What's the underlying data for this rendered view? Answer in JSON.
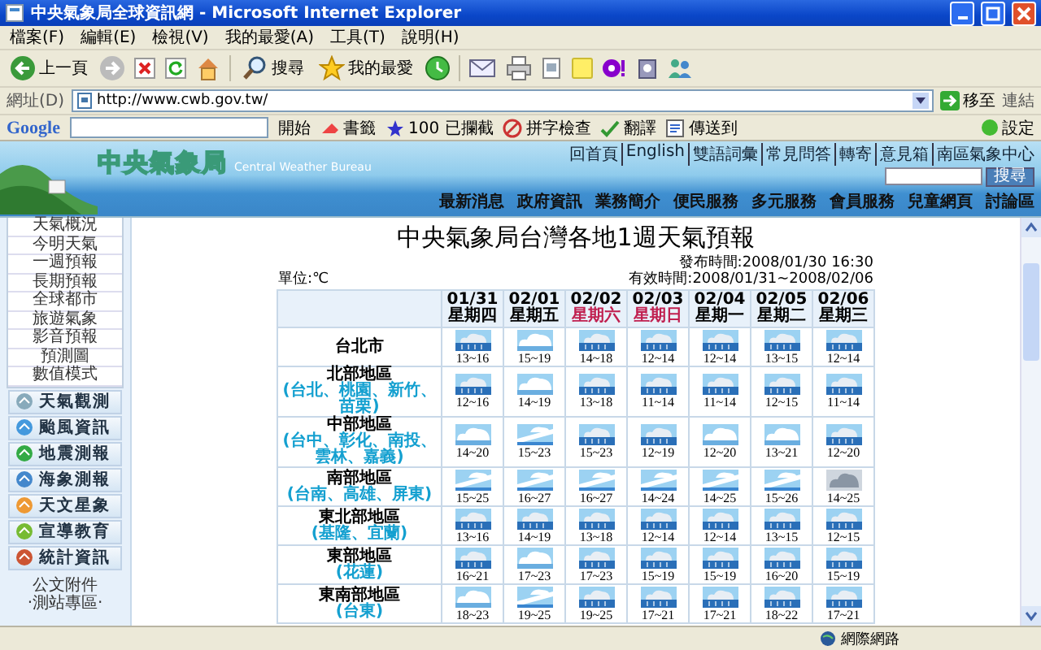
{
  "window": {
    "title": "中央氣象局全球資訊網 - Microsoft Internet Explorer"
  },
  "menu_bar": [
    "檔案(F)",
    "編輯(E)",
    "檢視(V)",
    "我的最愛(A)",
    "工具(T)",
    "說明(H)"
  ],
  "toolbar": {
    "back": "上一頁",
    "search": "搜尋",
    "favorites": "我的最愛"
  },
  "address_bar": {
    "label": "網址(D)",
    "value": "http://www.cwb.gov.tw/",
    "go": "移至",
    "links": "連結"
  },
  "google_toolbar": {
    "logo": "Google",
    "search": "開始",
    "items": [
      "書籤",
      "100 已攔截",
      "拼字檢查",
      "翻譯",
      "傳送到"
    ],
    "settings": "設定"
  },
  "site_header": {
    "logo": "中央氣象局",
    "logo_subtitle": "Central Weather Bureau",
    "top_links": [
      "回首頁",
      "English",
      "雙語詞彙",
      "常見問答",
      "轉寄",
      "意見箱",
      "南區氣象中心"
    ],
    "search_button": "搜尋",
    "nav": [
      "最新消息",
      "政府資訊",
      "業務簡介",
      "便民服務",
      "多元服務",
      "會員服務",
      "兒童網頁",
      "討論區"
    ]
  },
  "sidebar": {
    "links": [
      "天氣概況",
      "今明天氣",
      "一週預報",
      "長期預報",
      "全球都市",
      "旅遊氣象",
      "影音預報",
      "預測圖",
      "數值模式"
    ],
    "sections": [
      "天氣觀測",
      "颱風資訊",
      "地震測報",
      "海象測報",
      "天文星象",
      "宣導教育",
      "統計資訊"
    ],
    "footer_links": [
      "公文附件",
      "‧測站專區‧"
    ]
  },
  "forecast": {
    "title": "中央氣象局台灣各地1週天氣預報",
    "unit": "單位:℃",
    "published": "發布時間:2008/01/30 16:30",
    "valid": "有效時間:2008/01/31~2008/02/06",
    "days": [
      {
        "date": "01/31",
        "weekday": "星期四",
        "weekend": false
      },
      {
        "date": "02/01",
        "weekday": "星期五",
        "weekend": false
      },
      {
        "date": "02/02",
        "weekday": "星期六",
        "weekend": true
      },
      {
        "date": "02/03",
        "weekday": "星期日",
        "weekend": true
      },
      {
        "date": "02/04",
        "weekday": "星期一",
        "weekend": false
      },
      {
        "date": "02/05",
        "weekday": "星期二",
        "weekend": false
      },
      {
        "date": "02/06",
        "weekday": "星期三",
        "weekend": false
      }
    ],
    "regions": [
      {
        "name": "台北市",
        "cells": [
          {
            "kind": "rain",
            "temp": "13~16"
          },
          {
            "kind": "cloudy",
            "temp": "15~19"
          },
          {
            "kind": "rain",
            "temp": "14~18"
          },
          {
            "kind": "rain",
            "temp": "12~14"
          },
          {
            "kind": "rain",
            "temp": "12~14"
          },
          {
            "kind": "rain",
            "temp": "13~15"
          },
          {
            "kind": "rain",
            "temp": "12~14"
          }
        ]
      },
      {
        "name": "北部地區",
        "areas": "(台北、桃園、新竹、苗栗)",
        "cells": [
          {
            "kind": "rain",
            "temp": "12~16"
          },
          {
            "kind": "cloudy",
            "temp": "14~19"
          },
          {
            "kind": "rain",
            "temp": "13~18"
          },
          {
            "kind": "rain",
            "temp": "11~14"
          },
          {
            "kind": "rain",
            "temp": "11~14"
          },
          {
            "kind": "rain",
            "temp": "12~15"
          },
          {
            "kind": "rain",
            "temp": "11~14"
          }
        ]
      },
      {
        "name": "中部地區",
        "areas": "(台中、彰化、南投、雲林、嘉義)",
        "cells": [
          {
            "kind": "cloudy",
            "temp": "14~20"
          },
          {
            "kind": "partly",
            "temp": "15~23"
          },
          {
            "kind": "rain",
            "temp": "15~23"
          },
          {
            "kind": "rain",
            "temp": "12~19"
          },
          {
            "kind": "cloudy",
            "temp": "12~20"
          },
          {
            "kind": "cloudy",
            "temp": "13~21"
          },
          {
            "kind": "rain",
            "temp": "12~20"
          }
        ]
      },
      {
        "name": "南部地區",
        "areas": "(台南、高雄、屏東)",
        "cells": [
          {
            "kind": "partly",
            "temp": "15~25"
          },
          {
            "kind": "partly",
            "temp": "16~27"
          },
          {
            "kind": "partly",
            "temp": "16~27"
          },
          {
            "kind": "partly",
            "temp": "14~24"
          },
          {
            "kind": "partly",
            "temp": "14~25"
          },
          {
            "kind": "partly",
            "temp": "15~26"
          },
          {
            "kind": "overcast",
            "temp": "14~25"
          }
        ]
      },
      {
        "name": "東北部地區",
        "areas": "(基隆、宜蘭)",
        "cells": [
          {
            "kind": "rain",
            "temp": "13~16"
          },
          {
            "kind": "rain",
            "temp": "14~19"
          },
          {
            "kind": "rain",
            "temp": "13~18"
          },
          {
            "kind": "rain",
            "temp": "12~14"
          },
          {
            "kind": "rain",
            "temp": "12~14"
          },
          {
            "kind": "rain",
            "temp": "13~15"
          },
          {
            "kind": "rain",
            "temp": "12~15"
          }
        ]
      },
      {
        "name": "東部地區",
        "areas": "(花蓮)",
        "cells": [
          {
            "kind": "rain",
            "temp": "16~21"
          },
          {
            "kind": "cloudy",
            "temp": "17~23"
          },
          {
            "kind": "rain",
            "temp": "17~23"
          },
          {
            "kind": "rain",
            "temp": "15~19"
          },
          {
            "kind": "rain",
            "temp": "15~19"
          },
          {
            "kind": "rain",
            "temp": "16~20"
          },
          {
            "kind": "rain",
            "temp": "15~19"
          }
        ]
      },
      {
        "name": "東南部地區",
        "areas": "(台東)",
        "cells": [
          {
            "kind": "cloudy",
            "temp": "18~23"
          },
          {
            "kind": "partly",
            "temp": "19~25"
          },
          {
            "kind": "rain",
            "temp": "19~25"
          },
          {
            "kind": "rain",
            "temp": "17~21"
          },
          {
            "kind": "rain",
            "temp": "17~21"
          },
          {
            "kind": "rain",
            "temp": "18~22"
          },
          {
            "kind": "rain",
            "temp": "17~21"
          }
        ]
      }
    ]
  },
  "status_bar": {
    "zone": "網際網路"
  }
}
